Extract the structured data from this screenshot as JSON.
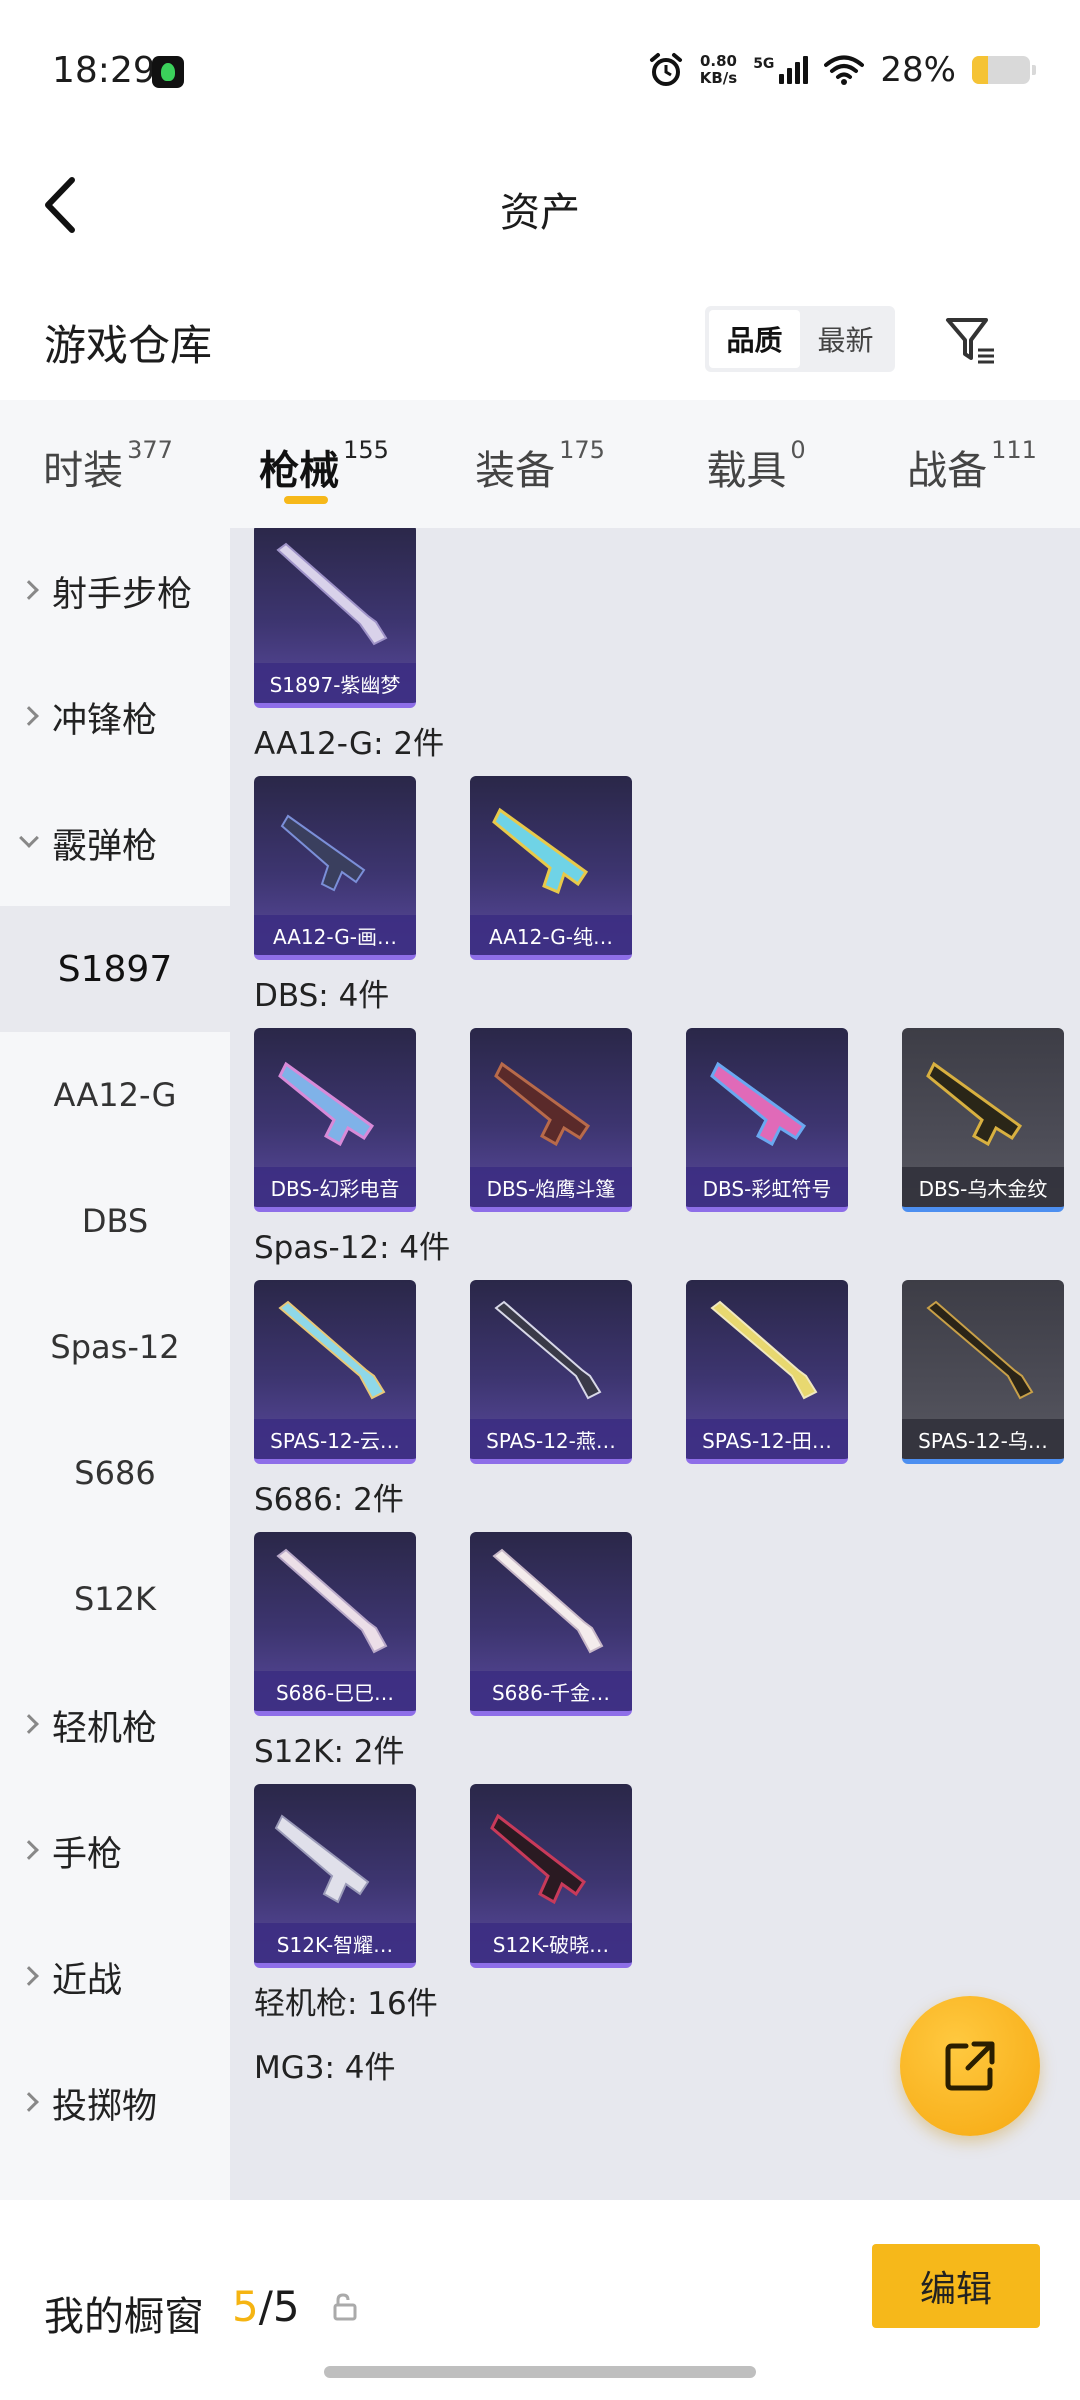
{
  "status_bar": {
    "time": "18:29",
    "net_speed_value": "0.80",
    "net_speed_unit": "KB/s",
    "network": "5G",
    "battery_percent": "28%",
    "battery_level": 0.28
  },
  "header": {
    "title": "资产"
  },
  "warehouse": {
    "title": "游戏仓库",
    "sort_options": [
      "品质",
      "最新"
    ],
    "sort_selected": "品质"
  },
  "tabs": [
    {
      "label": "时装",
      "count": "377"
    },
    {
      "label": "枪械",
      "count": "155",
      "active": true
    },
    {
      "label": "装备",
      "count": "175"
    },
    {
      "label": "载具",
      "count": "0"
    },
    {
      "label": "战备",
      "count": "111"
    }
  ],
  "sidebar": {
    "items": [
      {
        "label": "射手步枪"
      },
      {
        "label": "冲锋枪"
      },
      {
        "label": "霰弹枪"
      },
      {
        "label": "S1897"
      },
      {
        "label": "AA12-G"
      },
      {
        "label": "DBS"
      },
      {
        "label": "Spas-12"
      },
      {
        "label": "S686"
      },
      {
        "label": "S12K"
      },
      {
        "label": "轻机枪"
      },
      {
        "label": "手枪"
      },
      {
        "label": "近战"
      },
      {
        "label": "投掷物"
      }
    ]
  },
  "content": {
    "top_item": {
      "label": "S1897-紫幽梦"
    },
    "sections": [
      {
        "title": "AA12-G: 2件",
        "items": [
          {
            "label": "AA12-G-画…"
          },
          {
            "label": "AA12-G-纯…"
          }
        ]
      },
      {
        "title": "DBS: 4件",
        "items": [
          {
            "label": "DBS-幻彩电音"
          },
          {
            "label": "DBS-焰鹰斗篷"
          },
          {
            "label": "DBS-彩虹符号"
          },
          {
            "label": "DBS-乌木金纹"
          }
        ]
      },
      {
        "title": "Spas-12: 4件",
        "items": [
          {
            "label": "SPAS-12-云…"
          },
          {
            "label": "SPAS-12-燕…"
          },
          {
            "label": "SPAS-12-田…"
          },
          {
            "label": "SPAS-12-乌…"
          }
        ]
      },
      {
        "title": "S686: 2件",
        "items": [
          {
            "label": "S686-巳巳…"
          },
          {
            "label": "S686-千金…"
          }
        ]
      },
      {
        "title": "S12K: 2件",
        "items": [
          {
            "label": "S12K-智耀…"
          },
          {
            "label": "S12K-破晓…"
          }
        ]
      },
      {
        "title": "轻机枪: 16件"
      },
      {
        "title": "MG3: 4件"
      }
    ]
  },
  "bottom_bar": {
    "showcase_label": "我的橱窗",
    "showcase_used": "5",
    "showcase_total": "/5",
    "edit_label": "编辑"
  },
  "colors": {
    "accent": "#f6b81a",
    "tab_bar_bg": "#f6f7f9",
    "content_bg": "#e7e8ee",
    "card_purple": "#3d3570",
    "card_dark": "#4c4c56"
  }
}
